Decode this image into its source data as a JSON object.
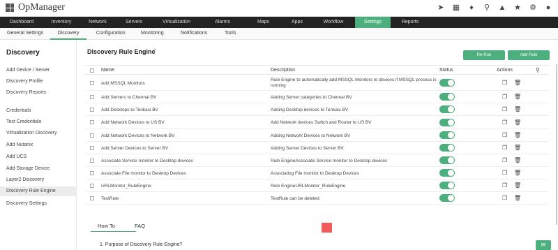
{
  "app": {
    "title": "OpManager"
  },
  "nav": {
    "tabs": [
      "Dashboard",
      "Inventory",
      "Network",
      "Servers",
      "Virtualization",
      "Alarms",
      "Maps",
      "Apps",
      "Workflow",
      "Settings",
      "Reports"
    ],
    "active": "Settings"
  },
  "subnav": {
    "tabs": [
      "General Settings",
      "Discovery",
      "Configuration",
      "Monitoring",
      "Notifications",
      "Tools"
    ],
    "active": "Discovery"
  },
  "sidebar": {
    "title": "Discovery",
    "items": [
      "Add Device / Server",
      "Discovery Profile",
      "Discovery Reports",
      "Credentials",
      "Test Credentials",
      "Virtualization Discovery",
      "Add Nutanix",
      "Add UCS",
      "Add Storage Device",
      "Layer2 Discovery",
      "Discovery Rule Engine",
      "Discovery Settings"
    ],
    "active": "Discovery Rule Engine"
  },
  "main": {
    "title": "Discovery Rule Engine",
    "help_icon": "?",
    "rerun_label": "Re-Run",
    "add_rule_label": "Add Rule"
  },
  "table": {
    "headers": {
      "name": "Name",
      "description": "Description",
      "status": "Status",
      "actions": "Actions"
    },
    "rows": [
      {
        "name": "Add MSSQL Monitors",
        "description": "Rule Engine to automatically add MSSQL Monitors to devices if MSSQL process is running",
        "enabled": true
      },
      {
        "name": "Add Servers to Chennai BV",
        "description": "Adding Server categories to Chennai BV",
        "enabled": true
      },
      {
        "name": "Add Desktops to Tenkasi BV",
        "description": "Adding Desktop devices to Tenkasi BV",
        "enabled": true
      },
      {
        "name": "Add Network Devices to US BV",
        "description": "Add Network devices Switch and Router to US BV",
        "enabled": true
      },
      {
        "name": "Add Network Devices to Network BV",
        "description": "Adding Network Devices to Network BV",
        "enabled": true
      },
      {
        "name": "Add Server Devices to Server BV",
        "description": "Adding Server Devices to Server BV",
        "enabled": true
      },
      {
        "name": "Associate Service monitor to Desktop devices",
        "description": "Rule EngineAssociate Service monitor to Desktop devices",
        "enabled": true
      },
      {
        "name": "Associate File monitor to Desktop Devices",
        "description": "Associating File monitor to Desktop Devices",
        "enabled": true
      },
      {
        "name": "URLMonitor_RuleEngine",
        "description": "Rule EngineURLMonitor_RuleEngine",
        "enabled": true
      },
      {
        "name": "TestRule",
        "description": "TestRule can be deleted",
        "enabled": true
      }
    ]
  },
  "help": {
    "tabs": [
      "How To",
      "FAQ"
    ],
    "active": "How To",
    "question": "1. Purpose of Discovery Rule Engine?"
  },
  "colors": {
    "accent": "#4caf7d",
    "nav_bg": "#232323",
    "red_marker": "#f45b5b"
  },
  "icons": [
    "grid-logo-icon",
    "rocket-icon",
    "monitor-icon",
    "bell-icon",
    "search-icon",
    "alarm-icon",
    "plug-icon",
    "gear-icon",
    "user-icon",
    "copy-icon",
    "trash-icon",
    "chat-icon"
  ]
}
